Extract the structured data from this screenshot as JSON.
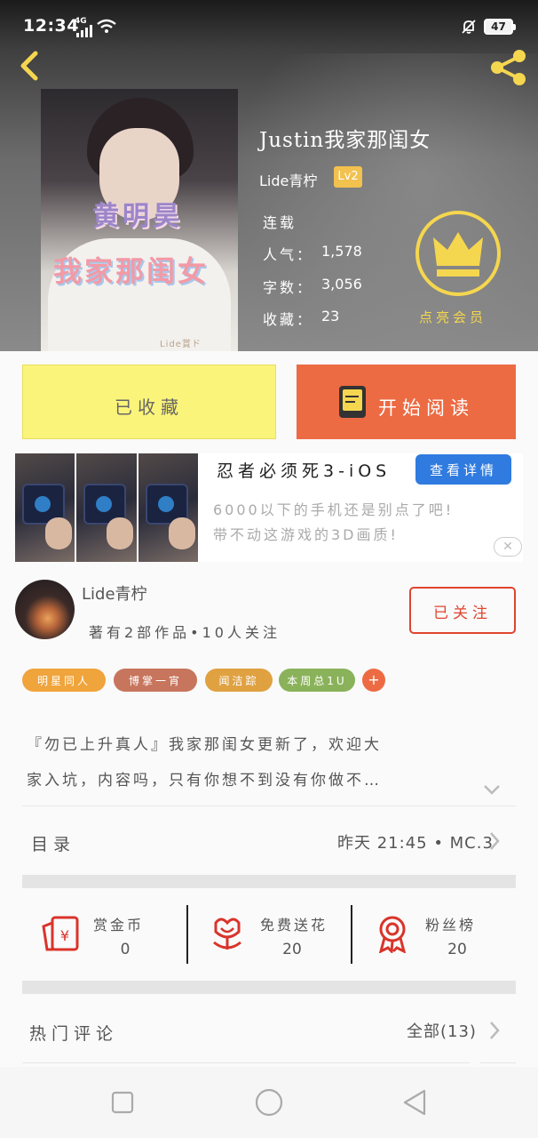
{
  "status_bar": {
    "time": "12:34",
    "network": "4G",
    "battery": "47"
  },
  "header": {
    "cover": {
      "line1": "黄明昊",
      "line2": "我家那闺女",
      "watermark": "Lide賞ド"
    },
    "book_title": "Justin我家那闺女",
    "author": "Lide青柠",
    "level_badge": "Lv2",
    "info": [
      {
        "label": "连载",
        "value": ""
      },
      {
        "label": "人气：",
        "value": "1,578"
      },
      {
        "label": "字数：",
        "value": "3,056"
      },
      {
        "label": "收藏：",
        "value": "23"
      }
    ],
    "vip_label": "点亮会员",
    "vip_icon": "crown-icon",
    "accent": "#f5d64f"
  },
  "actions": {
    "collected_label": "已收藏",
    "read_label": "开始阅读",
    "collected_color": "#fbf47a",
    "read_color": "#ec6b43"
  },
  "ad": {
    "title": "忍者必须死3-iOS",
    "detail_button": "查看详情",
    "desc_line1": "6000以下的手机还是别点了吧!",
    "desc_line2": "带不动这游戏的3D画质!",
    "close": "✕"
  },
  "author_box": {
    "name": "Lide青柠",
    "stats": "著有2部作品•10人关注",
    "follow_button": "已关注"
  },
  "tags": [
    {
      "label": "明星同人",
      "color": "#f0a43c"
    },
    {
      "label": "博掌一宵",
      "color": "#c7755d"
    },
    {
      "label": "闻洁踪",
      "color": "#e0a141"
    },
    {
      "label": "本周总1U",
      "color": "#8ab25a"
    }
  ],
  "tag_add": "+",
  "summary": {
    "line1": "『勿已上升真人』我家那闺女更新了，欢迎大",
    "line2": "家入坑，内容吗，只有你想不到没有你做不…"
  },
  "catalog": {
    "label": "目录",
    "update": "昨天 21:45 • MC.3"
  },
  "rewards": [
    {
      "label": "赏金币",
      "value": "0",
      "icon": "red-envelope-icon"
    },
    {
      "label": "免费送花",
      "value": "20",
      "icon": "flower-icon"
    },
    {
      "label": "粉丝榜",
      "value": "20",
      "icon": "medal-icon"
    }
  ],
  "comments": {
    "label": "热门评论",
    "all": "全部(13)"
  }
}
